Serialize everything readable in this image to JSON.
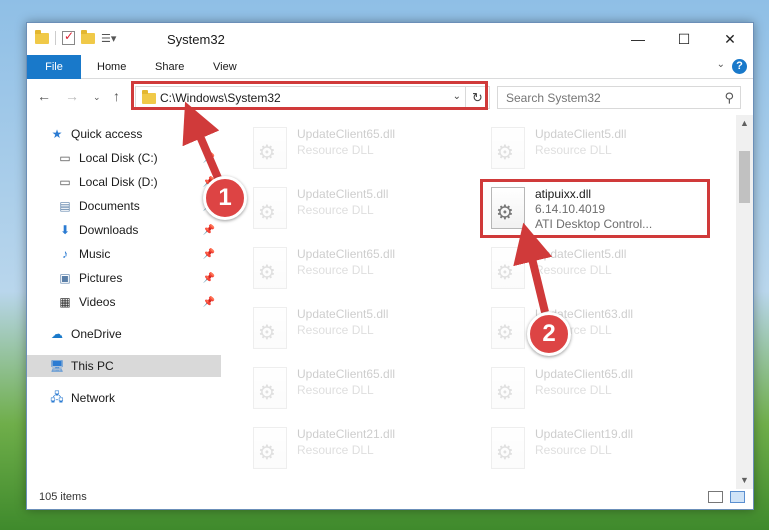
{
  "window": {
    "title": "System32"
  },
  "ribbon": {
    "tabs": [
      "File",
      "Home",
      "Share",
      "View"
    ],
    "help": "?"
  },
  "address": {
    "path": "C:\\Windows\\System32",
    "search_placeholder": "Search System32"
  },
  "sidebar": {
    "items": [
      {
        "label": "Quick access",
        "icon": "star-icon"
      },
      {
        "label": "Local Disk (C:)",
        "icon": "drive-icon",
        "pinned": true
      },
      {
        "label": "Local Disk (D:)",
        "icon": "drive-icon",
        "pinned": true
      },
      {
        "label": "Documents",
        "icon": "documents-icon",
        "pinned": true
      },
      {
        "label": "Downloads",
        "icon": "download-icon",
        "pinned": true
      },
      {
        "label": "Music",
        "icon": "music-icon",
        "pinned": true
      },
      {
        "label": "Pictures",
        "icon": "pictures-icon",
        "pinned": true
      },
      {
        "label": "Videos",
        "icon": "videos-icon",
        "pinned": true
      },
      {
        "label": "OneDrive",
        "icon": "cloud-icon"
      },
      {
        "label": "This PC",
        "icon": "computer-icon",
        "selected": true
      },
      {
        "label": "Network",
        "icon": "network-icon"
      }
    ]
  },
  "files": {
    "highlighted": {
      "name": "atipuixx.dll",
      "version": "6.14.10.4019",
      "description": "ATI Desktop Control..."
    },
    "ghost_type": "Resource DLL",
    "ghost_left": [
      "UpdateClient65.dll",
      "UpdateClient5.dll",
      "UpdateClient65.dll",
      "UpdateClient5.dll",
      "UpdateClient65.dll",
      "UpdateClient21.dll"
    ],
    "ghost_right": [
      "UpdateClient5.dll",
      "UpdateClient5.dll",
      "UpdateClient63.dll",
      "UpdateClient65.dll",
      "UpdateClient19.dll"
    ]
  },
  "status": {
    "count": "105 items"
  },
  "annotations": {
    "step1": "1",
    "step2": "2",
    "color": "#d03a3a"
  }
}
